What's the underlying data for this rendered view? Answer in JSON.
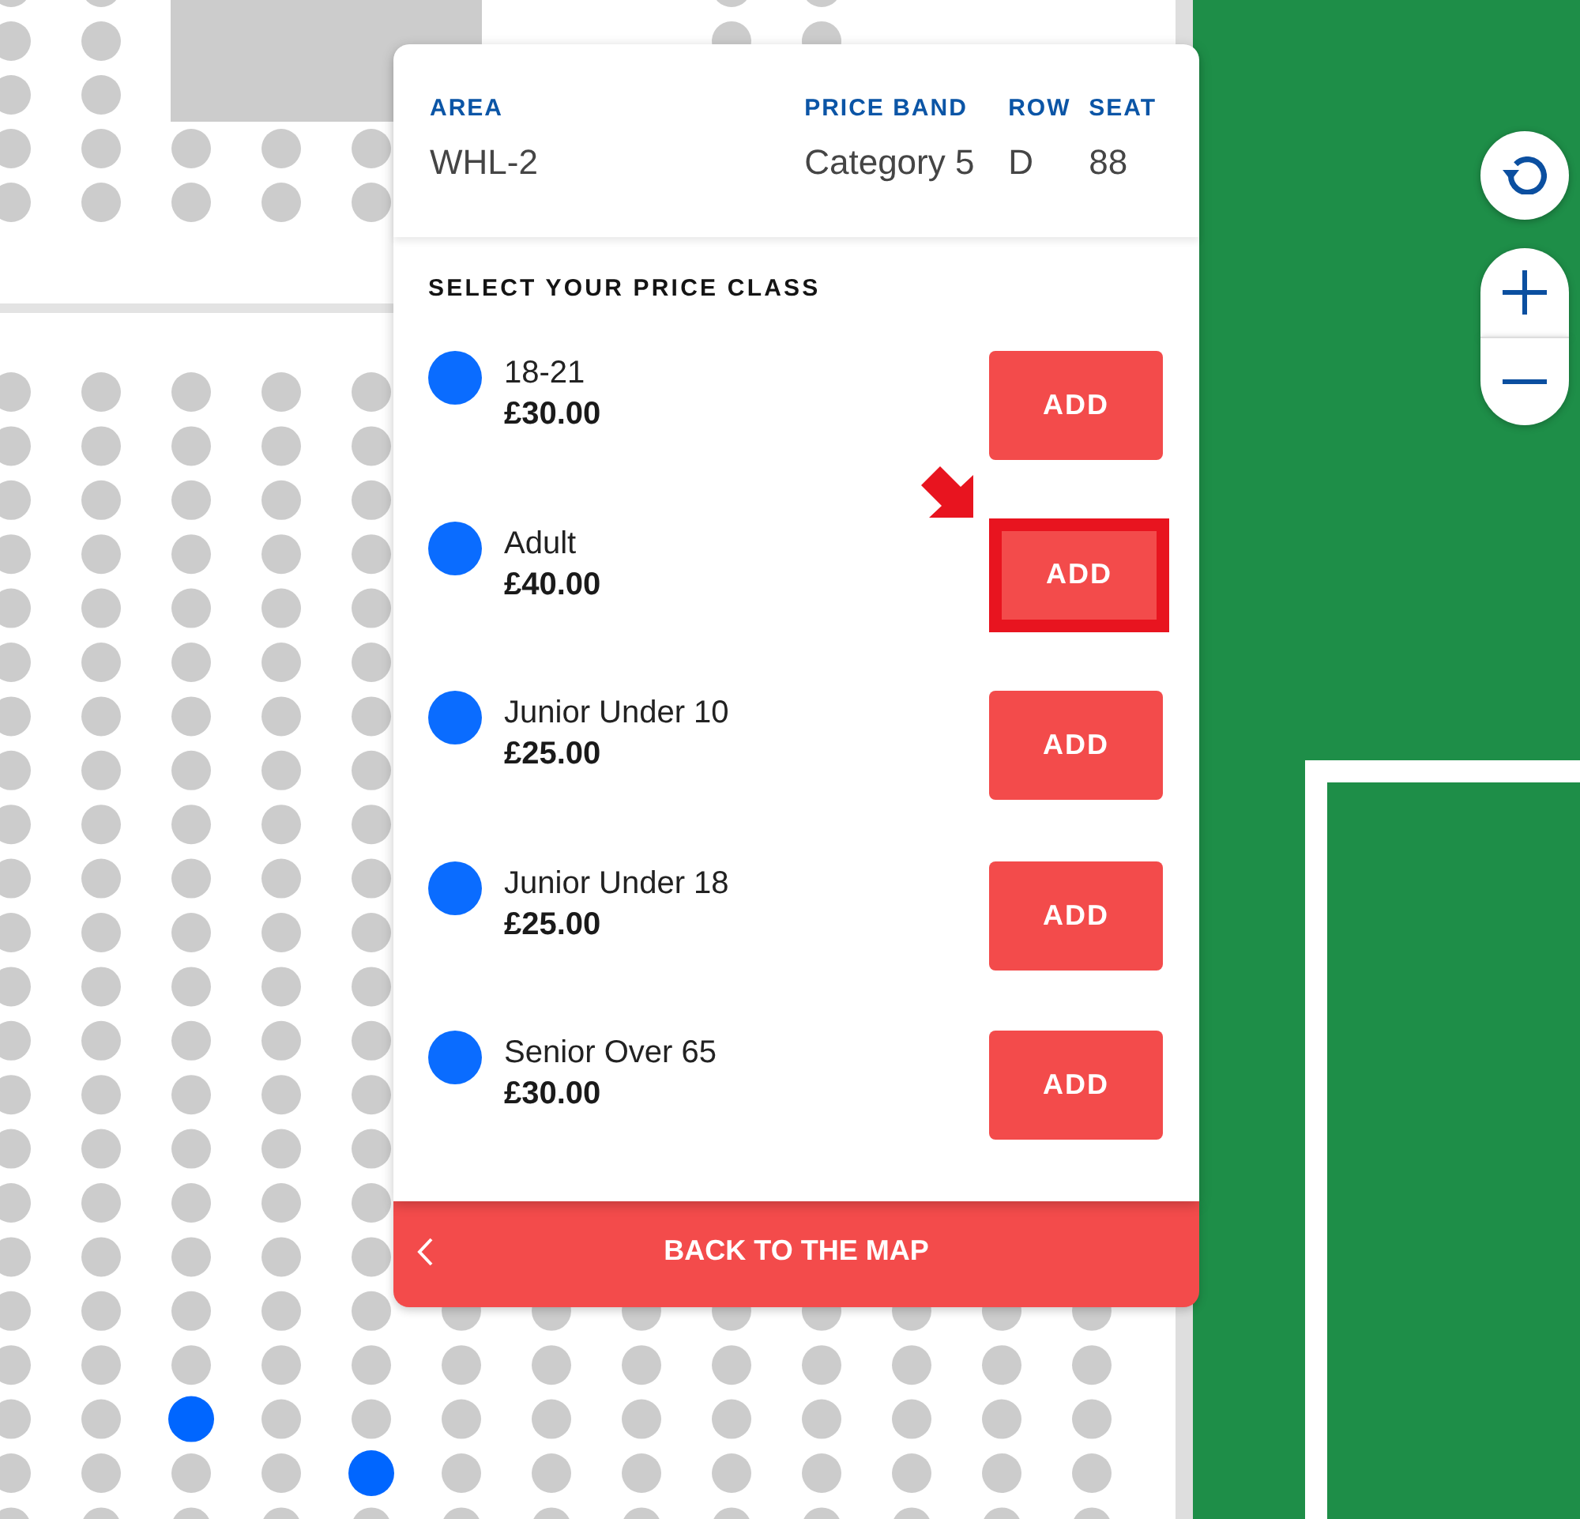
{
  "seat_info": {
    "area": {
      "label": "AREA",
      "value": "WHL-2"
    },
    "price_band": {
      "label": "PRICE BAND",
      "value": "Category 5"
    },
    "row": {
      "label": "ROW",
      "value": "D"
    },
    "seat": {
      "label": "SEAT",
      "value": "88"
    }
  },
  "price_classes": {
    "title": "SELECT YOUR PRICE CLASS",
    "items": [
      {
        "name": "18-21",
        "price": "£30.00",
        "button": "ADD",
        "highlighted": false
      },
      {
        "name": "Adult",
        "price": "£40.00",
        "button": "ADD",
        "highlighted": true
      },
      {
        "name": "Junior Under 10",
        "price": "£25.00",
        "button": "ADD",
        "highlighted": false
      },
      {
        "name": "Junior Under 18",
        "price": "£25.00",
        "button": "ADD",
        "highlighted": false
      },
      {
        "name": "Senior Over 65",
        "price": "£30.00",
        "button": "ADD",
        "highlighted": false
      }
    ]
  },
  "back_button": {
    "label": "BACK TO THE MAP"
  },
  "seat_map": {
    "blocks": [
      {
        "rows": [
          {
            "seats": [
              {
                "available": false
              },
              {
                "available": false
              }
            ]
          },
          {
            "seats": [
              {
                "available": false
              },
              {
                "available": false
              }
            ]
          },
          {
            "seats": [
              {
                "available": false
              },
              {
                "available": false
              }
            ]
          },
          {
            "seats": [
              {
                "available": false
              },
              {
                "available": false
              },
              {
                "available": false
              },
              {
                "available": false
              },
              {
                "available": false
              }
            ]
          },
          {
            "seats": [
              {
                "available": false
              },
              {
                "available": false
              },
              {
                "available": false
              },
              {
                "available": false
              },
              {
                "available": false
              }
            ]
          }
        ]
      },
      {
        "rows": [
          {
            "seats": [
              {
                "available": false
              },
              {
                "available": false
              }
            ]
          },
          {
            "seats": [
              {
                "available": false
              },
              {
                "available": false
              }
            ]
          }
        ]
      },
      {
        "rows": [
          {
            "seats": [
              {
                "available": false
              },
              {
                "available": false
              },
              {
                "available": false
              },
              {
                "available": false
              },
              {
                "available": false
              }
            ]
          },
          {
            "seats": [
              {
                "available": false
              },
              {
                "available": false
              },
              {
                "available": false
              },
              {
                "available": false
              },
              {
                "available": false
              }
            ]
          },
          {
            "seats": [
              {
                "available": false
              },
              {
                "available": false
              },
              {
                "available": false
              },
              {
                "available": false
              },
              {
                "available": false
              }
            ]
          },
          {
            "seats": [
              {
                "available": false
              },
              {
                "available": false
              },
              {
                "available": false
              },
              {
                "available": false
              },
              {
                "available": false
              }
            ]
          },
          {
            "seats": [
              {
                "available": false
              },
              {
                "available": false
              },
              {
                "available": false
              },
              {
                "available": false
              },
              {
                "available": false
              }
            ]
          },
          {
            "seats": [
              {
                "available": false
              },
              {
                "available": false
              },
              {
                "available": false
              },
              {
                "available": false
              },
              {
                "available": false
              }
            ]
          },
          {
            "seats": [
              {
                "available": false
              },
              {
                "available": false
              },
              {
                "available": false
              },
              {
                "available": false
              },
              {
                "available": false
              }
            ]
          },
          {
            "seats": [
              {
                "available": false
              },
              {
                "available": false
              },
              {
                "available": false
              },
              {
                "available": false
              },
              {
                "available": false
              }
            ]
          },
          {
            "seats": [
              {
                "available": false
              },
              {
                "available": false
              },
              {
                "available": false
              },
              {
                "available": false
              },
              {
                "available": false
              }
            ]
          },
          {
            "seats": [
              {
                "available": false
              },
              {
                "available": false
              },
              {
                "available": false
              },
              {
                "available": false
              },
              {
                "available": false
              }
            ]
          },
          {
            "seats": [
              {
                "available": false
              },
              {
                "available": false
              },
              {
                "available": false
              },
              {
                "available": false
              },
              {
                "available": false
              }
            ]
          },
          {
            "seats": [
              {
                "available": false
              },
              {
                "available": false
              },
              {
                "available": false
              },
              {
                "available": false
              },
              {
                "available": false
              }
            ]
          },
          {
            "seats": [
              {
                "available": false
              },
              {
                "available": false
              },
              {
                "available": false
              },
              {
                "available": false
              },
              {
                "available": false
              }
            ]
          },
          {
            "seats": [
              {
                "available": false
              },
              {
                "available": false
              },
              {
                "available": false
              },
              {
                "available": false
              },
              {
                "available": false
              }
            ]
          },
          {
            "seats": [
              {
                "available": false
              },
              {
                "available": false
              },
              {
                "available": false
              },
              {
                "available": false
              },
              {
                "available": false
              }
            ]
          },
          {
            "seats": [
              {
                "available": false
              },
              {
                "available": false
              },
              {
                "available": false
              },
              {
                "available": false
              },
              {
                "available": false
              }
            ]
          },
          {
            "seats": [
              {
                "available": false
              },
              {
                "available": false
              },
              {
                "available": false
              },
              {
                "available": false
              },
              {
                "available": false
              }
            ]
          },
          {
            "seats": [
              {
                "available": false
              },
              {
                "available": false
              },
              {
                "available": false
              },
              {
                "available": false
              },
              {
                "available": false
              },
              {
                "available": false
              },
              {
                "available": false
              },
              {
                "available": false
              },
              {
                "available": false
              },
              {
                "available": false
              },
              {
                "available": false
              },
              {
                "available": false
              },
              {
                "available": false
              }
            ]
          },
          {
            "seats": [
              {
                "available": false
              },
              {
                "available": false
              },
              {
                "available": false
              },
              {
                "available": false
              },
              {
                "available": false
              },
              {
                "available": false
              },
              {
                "available": false
              },
              {
                "available": false
              },
              {
                "available": false
              },
              {
                "available": false
              },
              {
                "available": false
              },
              {
                "available": false
              },
              {
                "available": false
              }
            ]
          },
          {
            "seats": [
              {
                "available": false
              },
              {
                "available": false
              },
              {
                "available": true
              },
              {
                "available": false
              },
              {
                "available": false
              },
              {
                "available": false
              },
              {
                "available": false
              },
              {
                "available": false
              },
              {
                "available": false
              },
              {
                "available": false
              },
              {
                "available": false
              },
              {
                "available": false
              },
              {
                "available": false
              }
            ]
          },
          {
            "seats": [
              {
                "available": false
              },
              {
                "available": false
              },
              {
                "available": false
              },
              {
                "available": false
              },
              {
                "available": true
              },
              {
                "available": false
              },
              {
                "available": false
              },
              {
                "available": false
              },
              {
                "available": false
              },
              {
                "available": false
              },
              {
                "available": false
              },
              {
                "available": false
              },
              {
                "available": false
              }
            ]
          },
          {
            "seats": [
              {
                "available": false
              },
              {
                "available": false
              },
              {
                "available": false
              },
              {
                "available": false
              },
              {
                "available": false
              },
              {
                "available": false
              },
              {
                "available": false
              },
              {
                "available": false
              },
              {
                "available": false
              },
              {
                "available": false
              },
              {
                "available": false
              },
              {
                "available": false
              },
              {
                "available": false
              }
            ]
          }
        ]
      }
    ]
  }
}
